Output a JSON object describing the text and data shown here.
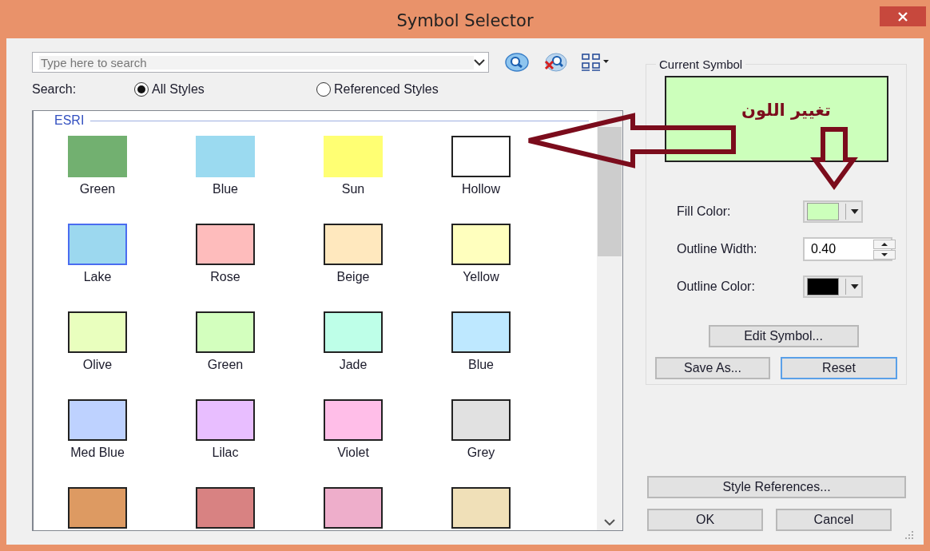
{
  "window": {
    "title": "Symbol Selector"
  },
  "search": {
    "placeholder": "Type here to search",
    "scope_label": "Search:",
    "scopes": [
      {
        "label": "All Styles",
        "selected": true
      },
      {
        "label": "Referenced Styles",
        "selected": false
      }
    ]
  },
  "gallery": {
    "group": "ESRI",
    "symbols": [
      {
        "label": "Green",
        "color": "#72b070",
        "kind": "plain"
      },
      {
        "label": "Blue",
        "color": "#9bdaf0",
        "kind": "plain"
      },
      {
        "label": "Sun",
        "color": "#ffff73",
        "kind": "plain"
      },
      {
        "label": "Hollow",
        "color": "#ffffff",
        "kind": "outlined"
      },
      {
        "label": "Lake",
        "color": "#9cd8ef",
        "kind": "accented"
      },
      {
        "label": "Rose",
        "color": "#febcbc",
        "kind": "outlined"
      },
      {
        "label": "Beige",
        "color": "#ffe8be",
        "kind": "outlined"
      },
      {
        "label": "Yellow",
        "color": "#ffffbe",
        "kind": "outlined"
      },
      {
        "label": "Olive",
        "color": "#e9ffbe",
        "kind": "outlined"
      },
      {
        "label": "Green",
        "color": "#d3ffbe",
        "kind": "outlined"
      },
      {
        "label": "Jade",
        "color": "#beffe8",
        "kind": "outlined"
      },
      {
        "label": "Blue",
        "color": "#bee8ff",
        "kind": "outlined"
      },
      {
        "label": "Med Blue",
        "color": "#bed2ff",
        "kind": "outlined"
      },
      {
        "label": "Lilac",
        "color": "#e8beff",
        "kind": "outlined"
      },
      {
        "label": "Violet",
        "color": "#ffbee8",
        "kind": "outlined"
      },
      {
        "label": "Grey",
        "color": "#e1e1e1",
        "kind": "outlined"
      },
      {
        "color": "#dd9a62",
        "kind": "outlined"
      },
      {
        "color": "#d88282",
        "kind": "outlined"
      },
      {
        "color": "#eeaecb",
        "kind": "outlined"
      },
      {
        "color": "#f0e0b8",
        "kind": "outlined"
      }
    ]
  },
  "current_symbol": {
    "title": "Current Symbol",
    "color": "#ccffbb",
    "properties": [
      {
        "kind": "color",
        "label": "Fill Color:",
        "color": "#ccffbb"
      },
      {
        "kind": "number",
        "label": "Outline Width:",
        "value": "0.40"
      },
      {
        "kind": "color",
        "label": "Outline Color:",
        "color": "#000000"
      }
    ],
    "edit_button": {
      "label": "Edit Symbol...",
      "focused": false
    },
    "buttons": [
      {
        "label": "Save As...",
        "focused": false
      },
      {
        "label": "Reset",
        "focused": true
      }
    ]
  },
  "footer": {
    "style_references": {
      "label": "Style References...",
      "focused": false
    },
    "buttons": [
      {
        "label": "OK",
        "focused": false
      },
      {
        "label": "Cancel",
        "focused": false
      }
    ]
  },
  "annotation": {
    "text": "تغيير اللون"
  }
}
